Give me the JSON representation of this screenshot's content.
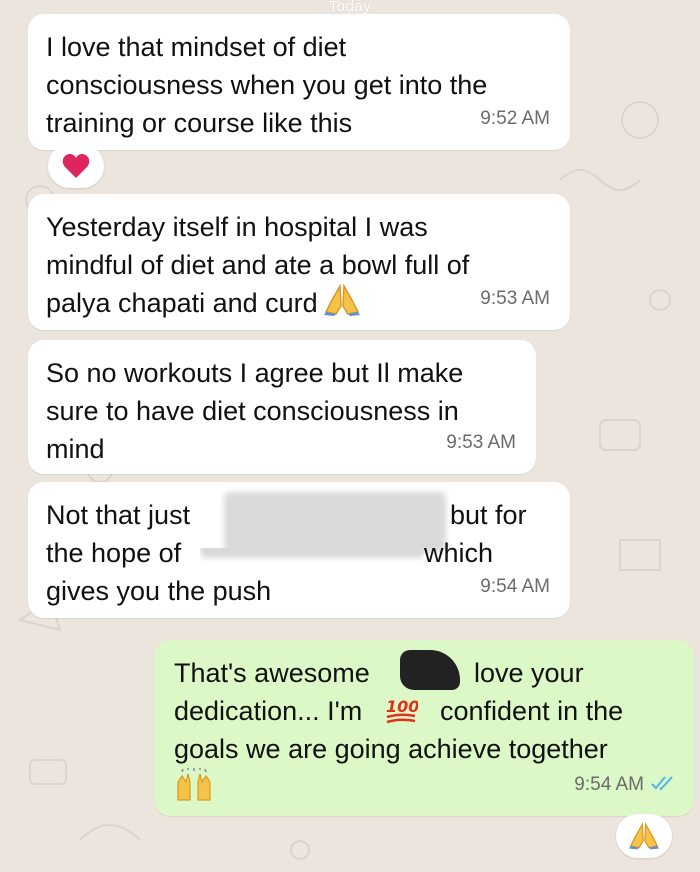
{
  "chat": {
    "date_separator": "Today",
    "messages": [
      {
        "id": "m1",
        "direction": "incoming",
        "text": "I love that mindset of diet\nconsciousness when you get into the\ntraining or course like this",
        "time": "9:52 AM",
        "reaction": "heart-icon"
      },
      {
        "id": "m2",
        "direction": "incoming",
        "text": "Yesterday itself in hospital I was\nmindful of diet and ate a bowl full of\npalya chapati and curd",
        "trailing_icon": "folded-hands-icon",
        "time": "9:53 AM"
      },
      {
        "id": "m3",
        "direction": "incoming",
        "text": "So no workouts I agree but Il make\nsure to have diet consciousness in\nmind",
        "time": "9:53 AM"
      },
      {
        "id": "m4",
        "direction": "incoming",
        "line1_start": "Not that just",
        "line1_end": "but for",
        "line2_start": "the hope of",
        "line2_end": "which",
        "line3": "gives you the push",
        "time": "9:54 AM"
      },
      {
        "id": "m5",
        "direction": "outgoing",
        "line1_start": "That's awesome",
        "line1_end": "love your",
        "line2_start": "dedication... I'm",
        "line2_end": "confident in the",
        "line3": "goals we are going achieve together",
        "time": "9:54 AM",
        "status": "read",
        "reaction": "folded-hands-icon"
      }
    ]
  },
  "colors": {
    "background": "#ece5dd",
    "incoming_bubble": "#ffffff",
    "outgoing_bubble": "#dcf8c6",
    "read_ticks": "#4fb6ec"
  }
}
